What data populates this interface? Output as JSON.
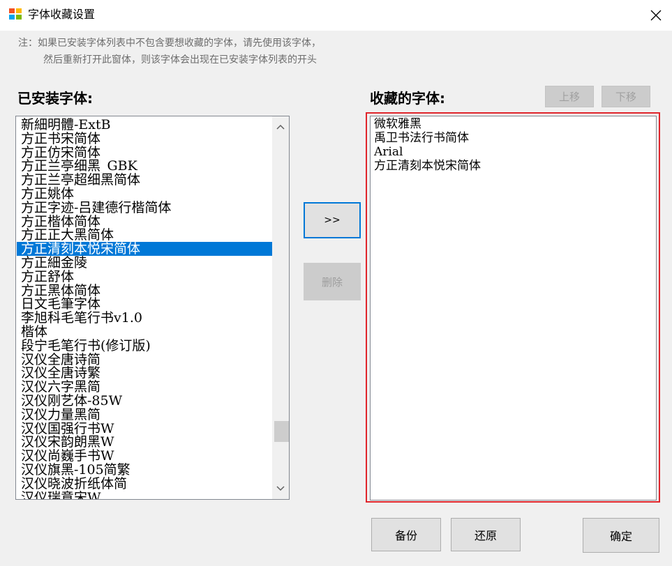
{
  "window": {
    "title": "字体收藏设置",
    "icon": "app-icon",
    "close_icon": "close-icon"
  },
  "note": {
    "line1": "注：如果已安装字体列表中不包含要想收藏的字体，请先使用该字体，",
    "line2": "然后重新打开此窗体，则该字体会出现在已安装字体列表的开头"
  },
  "installed": {
    "heading": "已安装字体:",
    "selected_index": 9,
    "items": [
      "新細明體-ExtB",
      "方正书宋简体",
      "方正仿宋简体",
      "方正兰亭细黑_GBK",
      "方正兰亭超细黑简体",
      "方正姚体",
      "方正字迹-吕建德行楷简体",
      "方正楷体简体",
      "方正正大黑简体",
      "方正清刻本悦宋简体",
      "方正細金陵",
      "方正舒体",
      "方正黑体简体",
      "日文毛筆字体",
      "李旭科毛笔行书v1.0",
      "楷体",
      "段宁毛笔行书(修订版)",
      "汉仪全唐诗简",
      "汉仪全唐诗繁",
      "汉仪六字黑简",
      "汉仪刚艺体-85W",
      "汉仪力量黑简",
      "汉仪国强行书W",
      "汉仪宋韵朗黑W",
      "汉仪尚巍手书W",
      "汉仪旗黑-105简繁",
      "汉仪晓波折纸体简",
      "汉仪瑞意宋W"
    ],
    "scroll_position": 0.88
  },
  "buttons": {
    "add": ">>",
    "delete": "删除",
    "move_up": "上移",
    "move_down": "下移",
    "backup": "备份",
    "restore": "还原",
    "ok": "确定"
  },
  "favorites": {
    "heading": "收藏的字体:",
    "items": [
      "微软雅黑",
      "禹卫书法行书简体",
      "Arial",
      "方正清刻本悦宋简体"
    ]
  },
  "colors": {
    "selection": "#0078d7",
    "highlight_border": "#e0252b",
    "focus_border": "#0078d7"
  }
}
